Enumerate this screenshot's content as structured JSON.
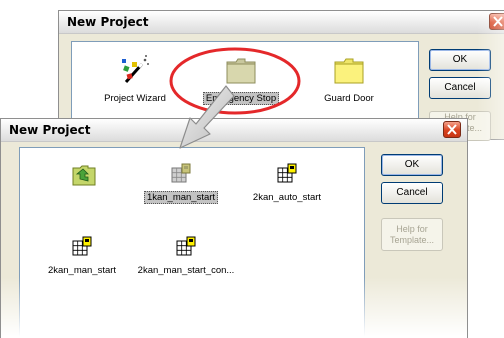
{
  "back_dialog": {
    "title": "New Project",
    "items": [
      {
        "label": "Project Wizard",
        "icon": "wizard-wand-icon"
      },
      {
        "label": "Emergency Stop",
        "icon": "folder-icon",
        "selected": true
      },
      {
        "label": "Guard Door",
        "icon": "folder-icon"
      }
    ],
    "ok_label": "OK",
    "cancel_label": "Cancel",
    "help_line1": "Help for",
    "help_line2": "Template..."
  },
  "front_dialog": {
    "title": "New Project",
    "items": [
      {
        "label": "",
        "icon": "folder-up-icon"
      },
      {
        "label": "1kan_man_start",
        "icon": "template-icon",
        "selected": true
      },
      {
        "label": "2kan_auto_start",
        "icon": "template-icon"
      },
      {
        "label": "2kan_man_start",
        "icon": "template-icon"
      },
      {
        "label": "2kan_man_start_con...",
        "icon": "template-icon"
      }
    ],
    "ok_label": "OK",
    "cancel_label": "Cancel",
    "help_line1": "Help for",
    "help_line2": "Template..."
  },
  "colors": {
    "highlight_ring": "#e4282a",
    "arrow_fill": "#d9d9d9",
    "dialog_bg": "#ece9d8"
  }
}
